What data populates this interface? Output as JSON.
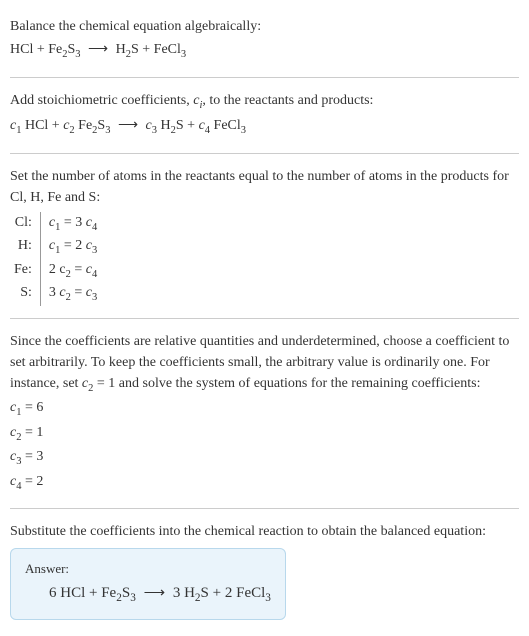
{
  "intro": {
    "line1": "Balance the chemical equation algebraically:",
    "eq_lhs1": "HCl + Fe",
    "eq_lhs2": "S",
    "eq_lhs3": "",
    "arrow": "⟶",
    "eq_rhs1": "H",
    "eq_rhs2": "S + FeCl",
    "sub2": "2",
    "sub3": "3"
  },
  "step2": {
    "text": "Add stoichiometric coefficients, ",
    "ci": "c",
    "ci_sub": "i",
    "text2": ", to the reactants and products:",
    "c1": "c",
    "n1": "1",
    "c2": "c",
    "n2": "2",
    "c3": "c",
    "n3": "3",
    "c4": "c",
    "n4": "4",
    "hcl": " HCl + ",
    "fe2s3": " Fe",
    "s3": "S",
    "mid_arrow": "⟶",
    "h2s": " H",
    "splus": "S + ",
    "fecl3": " FeCl",
    "plain_s": "S"
  },
  "step3": {
    "text1": "Set the number of atoms in the reactants equal to the number of atoms in the products for Cl, H, Fe and S:",
    "rows": [
      {
        "label": "Cl:",
        "lhs": "c",
        "lsub": "1",
        "eq": " = 3 ",
        "rhs": "c",
        "rsub": "4"
      },
      {
        "label": "H:",
        "lhs": "c",
        "lsub": "1",
        "eq": " = 2 ",
        "rhs": "c",
        "rsub": "3"
      },
      {
        "label": "Fe:",
        "lhs": "2 c",
        "lsub": "2",
        "eq": " = ",
        "rhs": "c",
        "rsub": "4"
      },
      {
        "label": "S:",
        "lhs": "3 c",
        "lsub": "2",
        "eq": " = ",
        "rhs": "c",
        "rsub": "3"
      }
    ]
  },
  "step4": {
    "text1": "Since the coefficients are relative quantities and underdetermined, choose a coefficient to set arbitrarily. To keep the coefficients small, the arbitrary value is ordinarily one. For instance, set ",
    "setc": "c",
    "setc_sub": "2",
    "text2": " = 1 and solve the system of equations for the remaining coefficients:",
    "coeffs": [
      {
        "c": "c",
        "sub": "1",
        "val": " = 6"
      },
      {
        "c": "c",
        "sub": "2",
        "val": " = 1"
      },
      {
        "c": "c",
        "sub": "3",
        "val": " = 3"
      },
      {
        "c": "c",
        "sub": "4",
        "val": " = 2"
      }
    ]
  },
  "step5": {
    "text": "Substitute the coefficients into the chemical reaction to obtain the balanced equation:"
  },
  "answer": {
    "label": "Answer:",
    "p1": "6 HCl + Fe",
    "s2": "2",
    "p2": "S",
    "s3": "3",
    "arrow": "⟶",
    "p3": "3 H",
    "p4": "S + 2 FeCl"
  },
  "chart_data": {
    "type": "table",
    "title": "Balanced chemical equation coefficients",
    "unbalanced_equation": "HCl + Fe2S3 ⟶ H2S + FeCl3",
    "atom_equations": [
      {
        "element": "Cl",
        "equation": "c1 = 3 c4"
      },
      {
        "element": "H",
        "equation": "c1 = 2 c3"
      },
      {
        "element": "Fe",
        "equation": "2 c2 = c4"
      },
      {
        "element": "S",
        "equation": "3 c2 = c3"
      }
    ],
    "coefficients": {
      "c1": 6,
      "c2": 1,
      "c3": 3,
      "c4": 2
    },
    "balanced_equation": "6 HCl + Fe2S3 ⟶ 3 H2S + 2 FeCl3"
  }
}
